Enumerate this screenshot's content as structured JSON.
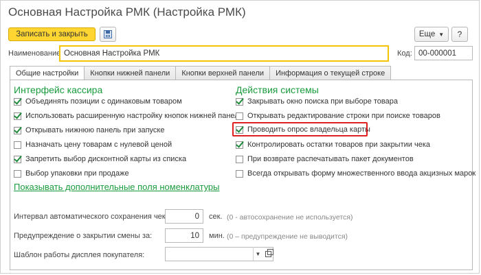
{
  "window": {
    "title": "Основная Настройка РМК (Настройка РМК)"
  },
  "toolbar": {
    "save_close_label": "Записать и закрыть",
    "save_icon": "floppy-disk-icon",
    "more_label": "Еще",
    "more_icon": "chevron-down-icon",
    "help_label": "?"
  },
  "header": {
    "name_label": "Наименование:",
    "name_value": "Основная Настройка РМК",
    "code_label": "Код:",
    "code_value": "00-000001"
  },
  "tabs": [
    {
      "label": "Общие настройки",
      "active": true
    },
    {
      "label": "Кнопки нижней панели",
      "active": false
    },
    {
      "label": "Кнопки верхней панели",
      "active": false
    },
    {
      "label": "Информация о текущей строке",
      "active": false
    }
  ],
  "cashier": {
    "title": "Интерфейс кассира",
    "items": [
      {
        "label": "Объединять позиции с одинаковым товаром",
        "checked": true
      },
      {
        "label": "Использовать расширенную настройку кнопок нижней панели",
        "checked": true
      },
      {
        "label": "Открывать нижнюю панель при запуске",
        "checked": true
      },
      {
        "label": "Назначать цену товарам с нулевой ценой",
        "checked": false
      },
      {
        "label": "Запретить выбор дисконтной карты из списка",
        "checked": true
      },
      {
        "label": "Выбор упаковки при продаже",
        "checked": false
      }
    ]
  },
  "system": {
    "title": "Действия системы",
    "items": [
      {
        "label": "Закрывать окно поиска при выборе товара",
        "checked": true
      },
      {
        "label": "Открывать редактирование строки при поиске товаров",
        "checked": false
      },
      {
        "label": "Проводить опрос владельца карты",
        "checked": true
      },
      {
        "label": "Контролировать остатки товаров при закрытии чека",
        "checked": true
      },
      {
        "label": "При возврате распечатывать пакет документов",
        "checked": false
      },
      {
        "label": "Всегда открывать форму множественного ввода акцизных марок",
        "checked": false
      }
    ]
  },
  "nomenclature_link": "Показывать дополнительные поля номенклатуры",
  "autosave": {
    "label": "Интервал автоматического сохранения чека:",
    "value": "0",
    "unit": "сек.",
    "hint": "(0 - автосохранение не используется)"
  },
  "shift_warning": {
    "label": "Предупреждение о закрытии смены за:",
    "value": "10",
    "unit": "мин.",
    "hint": "(0 – предупреждение не выводится)"
  },
  "display_template": {
    "label": "Шаблон работы дисплея покупателя:",
    "value": "",
    "dropdown_icon": "triangle-down-icon",
    "open_icon": "open-window-icon"
  },
  "colors": {
    "accent_green": "#1a9c3e",
    "primary_button": "#ffd631",
    "highlight_red": "#e02020",
    "focus_yellow": "#f5c400"
  }
}
